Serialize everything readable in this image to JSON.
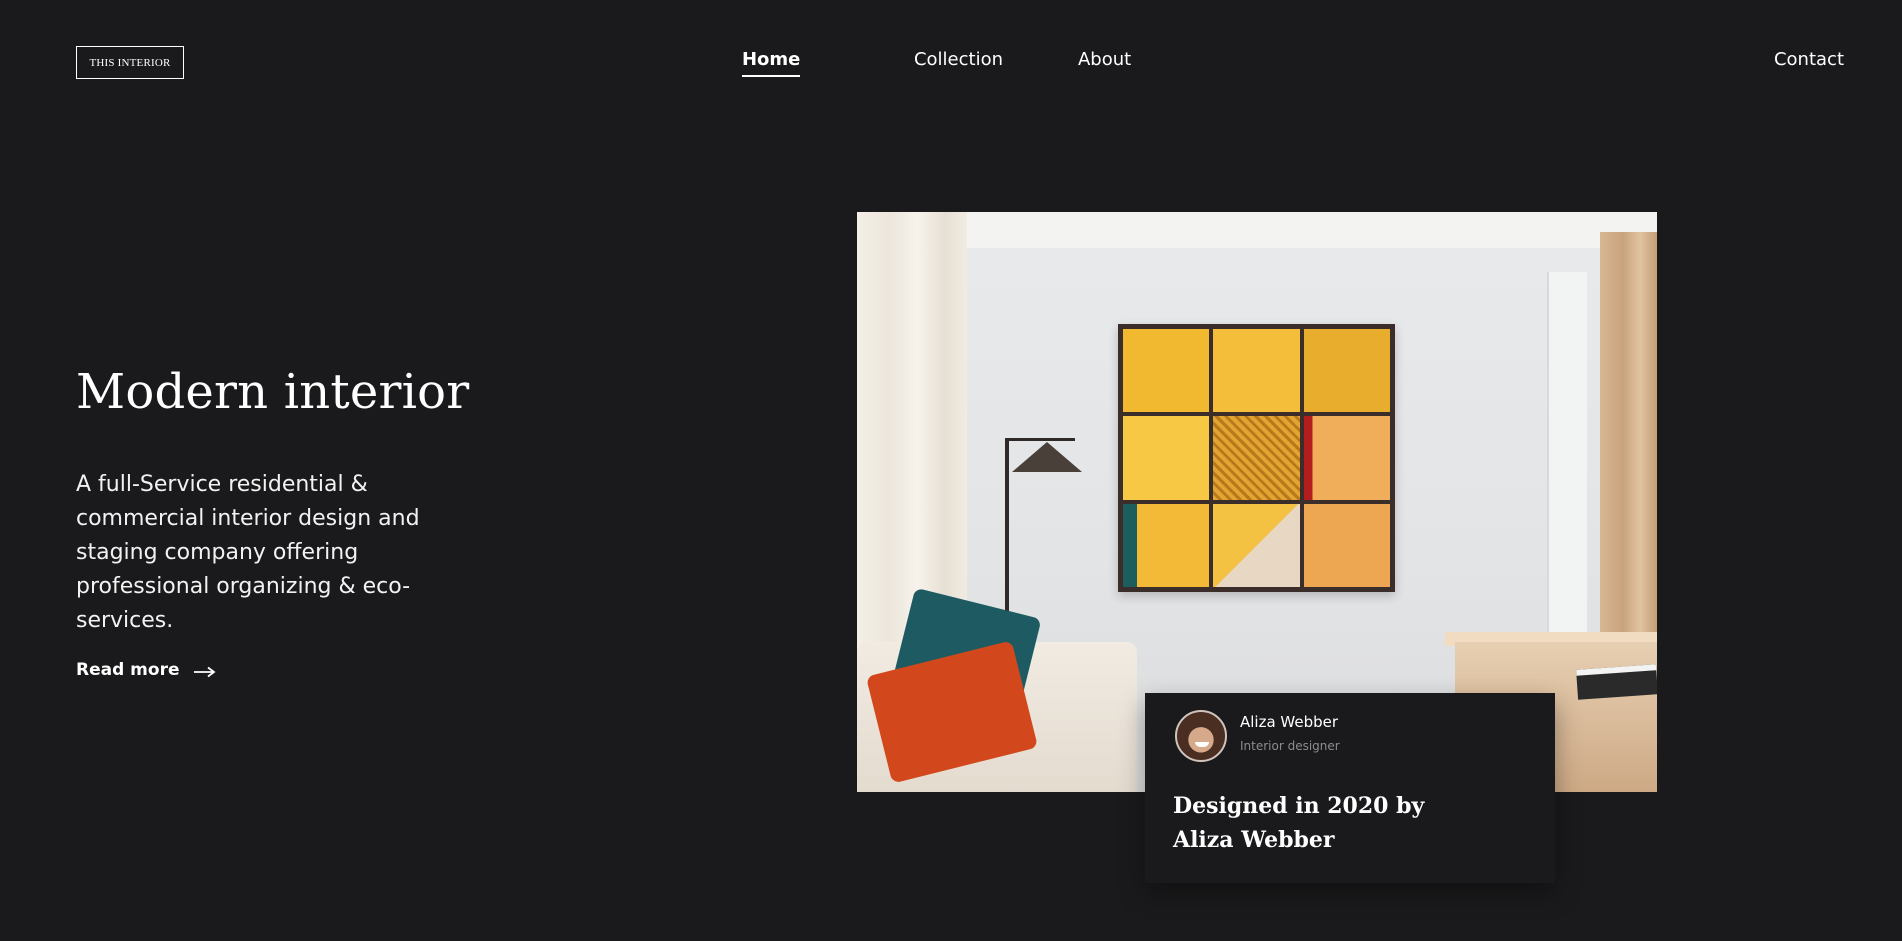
{
  "brand": {
    "logo_text": "THIS INTERIOR"
  },
  "nav": {
    "items": [
      {
        "label": "Home",
        "active": true
      },
      {
        "label": "Collection",
        "active": false
      },
      {
        "label": "About",
        "active": false
      },
      {
        "label": "Contact",
        "active": false
      }
    ]
  },
  "hero": {
    "title": "Modern interior",
    "description": "A full-Service residential & commercial interior design and staging company offering professional organizing & eco-services.",
    "read_more_label": "Read more",
    "read_more_icon": "arrow-right-icon"
  },
  "feature_image": {
    "alt": "Modern living room with yellow artwork, lamp, sofa and cushions"
  },
  "designer_card": {
    "name": "Aliza Webber",
    "role": "Interior designer",
    "title": "Designed in 2020 by Aliza Webber"
  },
  "colors": {
    "background": "#1a1a1c",
    "text": "#ffffff",
    "muted": "#8c8c8c"
  }
}
